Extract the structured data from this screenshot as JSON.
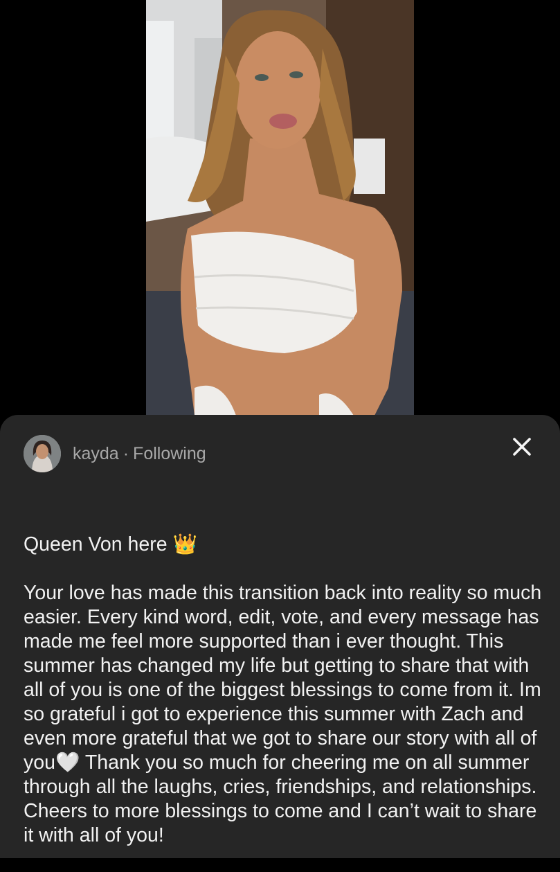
{
  "post": {
    "author": "kayda",
    "separator": "·",
    "follow_status": "Following",
    "title": "Queen Von here 👑",
    "body": "Your love has made this transition back into reality so much easier. Every kind word, edit, vote, and every message has made me feel more supported than i ever thought. This summer has changed my life but getting to share that with all of you is one of the biggest blessings to come from it. Im so grateful i got to experience this summer with Zach and even more grateful that we got to share our story with all of you🤍 Thank you so much for cheering me on all summer through all the laughs, cries, friendships, and relationships. Cheers to more blessings to come and I can’t wait to share it with all of you!"
  },
  "icons": {
    "close": "close-icon",
    "avatar": "avatar-image"
  },
  "colors": {
    "sheet_background": "#262626",
    "text_primary": "#f2f2f2",
    "text_secondary": "#a8a8a8",
    "page_background": "#000000"
  }
}
